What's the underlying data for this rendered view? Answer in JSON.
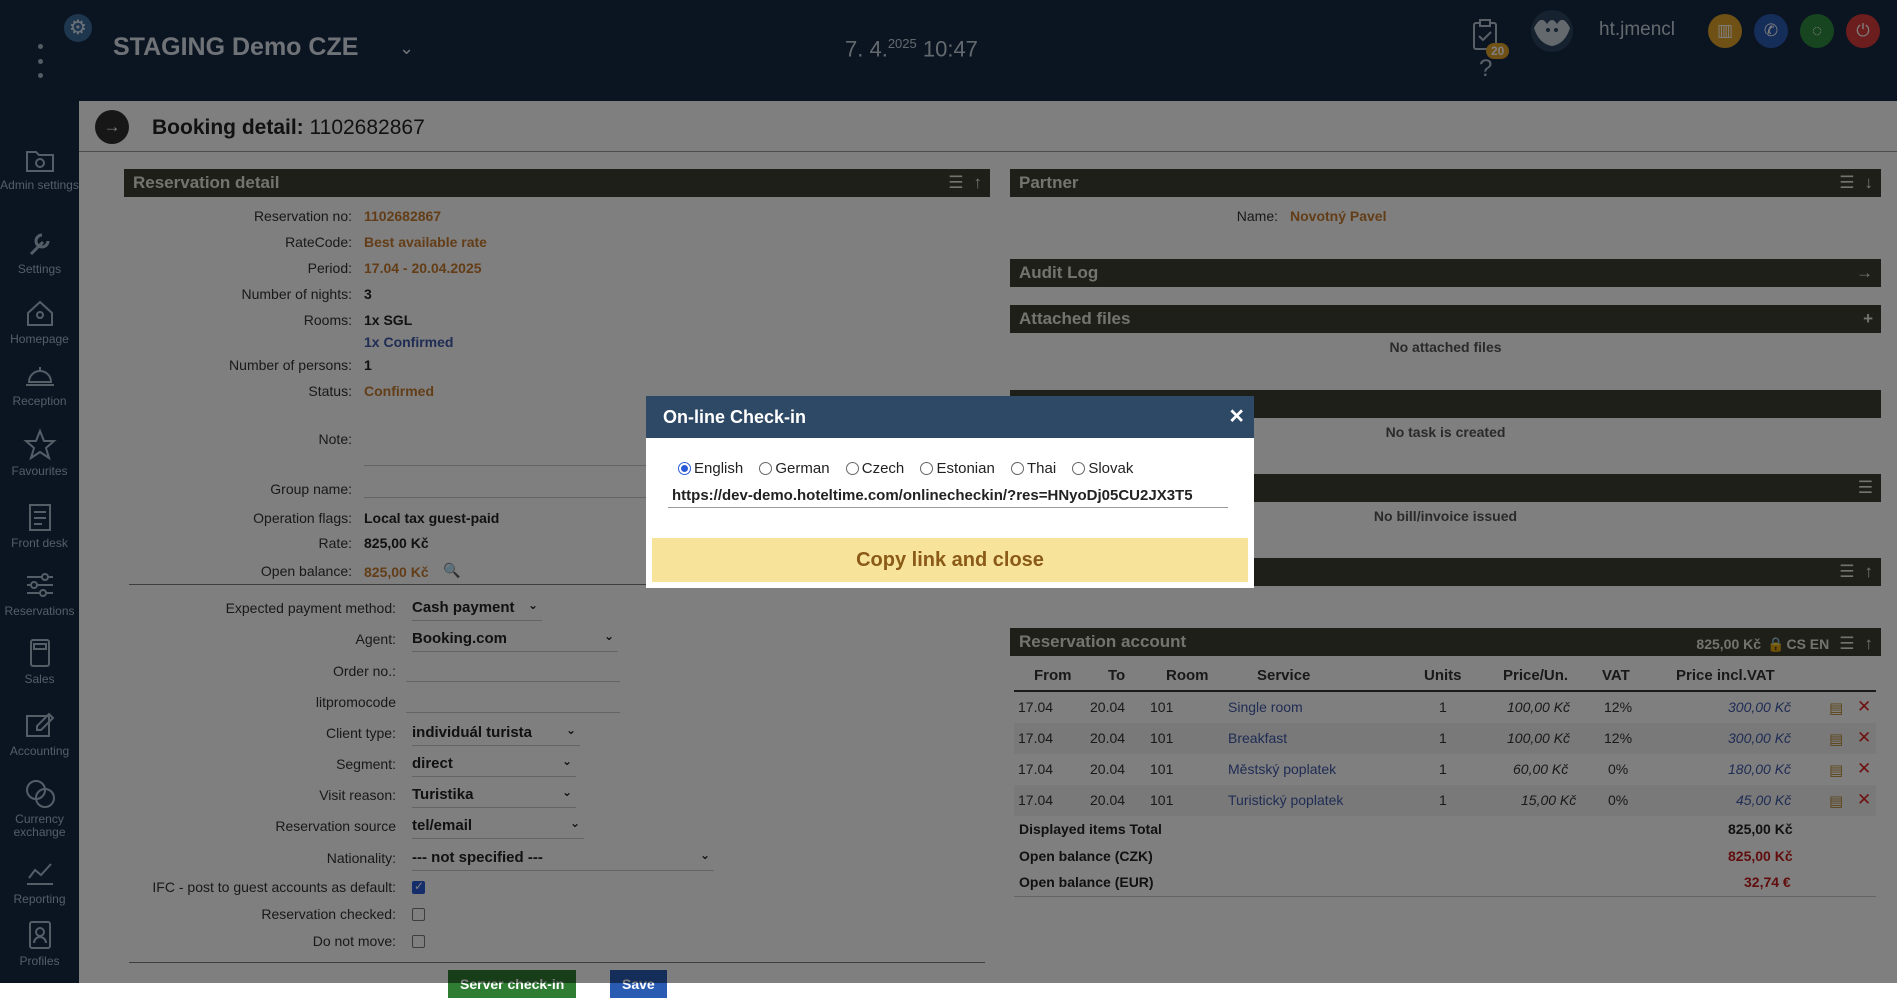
{
  "sidebar": {
    "items": [
      {
        "label": "Admin settings",
        "icon": "admin-settings-icon"
      },
      {
        "label": "Settings",
        "icon": "wrench-icon"
      },
      {
        "label": "Homepage",
        "icon": "home-icon"
      },
      {
        "label": "Reception",
        "icon": "bell-icon"
      },
      {
        "label": "Favourites",
        "icon": "star-icon"
      },
      {
        "label": "Front desk",
        "icon": "front-desk-icon"
      },
      {
        "label": "Reservations",
        "icon": "sliders-icon"
      },
      {
        "label": "Sales",
        "icon": "calculator-icon"
      },
      {
        "label": "Accounting",
        "icon": "accounting-icon"
      },
      {
        "label": "Currency exchange",
        "icon": "currency-icon"
      },
      {
        "label": "Reporting",
        "icon": "chart-icon"
      },
      {
        "label": "Profiles",
        "icon": "profiles-icon"
      }
    ]
  },
  "topbar": {
    "hotel": "STAGING Demo CZE",
    "date_day": "7. 4.",
    "date_year": "2025",
    "time": "10:47",
    "task_badge": "20",
    "user": "ht.jmencl"
  },
  "page": {
    "title_label": "Booking detail:",
    "title_value": "1102682867"
  },
  "reservation": {
    "panel_title": "Reservation detail",
    "fields": {
      "res_no_label": "Reservation no:",
      "res_no": "1102682867",
      "ratecode_label": "RateCode:",
      "ratecode": "Best available rate",
      "period_label": "Period:",
      "period": "17.04 - 20.04.2025",
      "nights_label": "Number of nights:",
      "nights": "3",
      "rooms_label": "Rooms:",
      "rooms": "1x SGL",
      "rooms_confirmed": "1x Confirmed",
      "persons_label": "Number of persons:",
      "persons": "1",
      "status_label": "Status:",
      "status": "Confirmed",
      "note_label": "Note:",
      "group_label": "Group name:",
      "flags_label": "Operation flags:",
      "flags": "Local tax guest-paid",
      "rate_label": "Rate:",
      "rate": "825,00 Kč",
      "balance_label": "Open balance:",
      "balance": "825,00 Kč"
    },
    "form": {
      "payment_label": "Expected payment method:",
      "payment": "Cash payment",
      "agent_label": "Agent:",
      "agent": "Booking.com",
      "order_label": "Order no.:",
      "promo_label": "litpromocode",
      "client_label": "Client type:",
      "client": "individuál turista",
      "segment_label": "Segment:",
      "segment": "direct",
      "visit_label": "Visit reason:",
      "visit": "Turistika",
      "source_label": "Reservation source",
      "source": "tel/email",
      "nationality_label": "Nationality:",
      "nationality": "--- not specified ---",
      "ifc_label": "IFC - post to guest accounts as default:",
      "checked_label": "Reservation checked:",
      "nomove_label": "Do not move:"
    }
  },
  "partner": {
    "panel_title": "Partner",
    "name_label": "Name:",
    "name": "Novotný Pavel"
  },
  "audit": {
    "panel_title": "Audit Log"
  },
  "files": {
    "panel_title": "Attached files",
    "empty": "No attached files"
  },
  "tasks": {
    "empty": "No task is created"
  },
  "bills": {
    "empty": "No bill/invoice issued"
  },
  "account": {
    "panel_title": "Reservation account",
    "summary": "825,00 Kč",
    "lang": "CS EN",
    "headers": [
      "From",
      "To",
      "Room",
      "Service",
      "Units",
      "Price/Un.",
      "VAT",
      "Price incl.VAT"
    ],
    "rows": [
      {
        "from": "17.04",
        "to": "20.04",
        "room": "101",
        "service": "Single room",
        "units": "1",
        "price": "100,00 Kč",
        "vat": "12%",
        "total": "300,00 Kč"
      },
      {
        "from": "17.04",
        "to": "20.04",
        "room": "101",
        "service": "Breakfast",
        "units": "1",
        "price": "100,00 Kč",
        "vat": "12%",
        "total": "300,00 Kč"
      },
      {
        "from": "17.04",
        "to": "20.04",
        "room": "101",
        "service": "Městský poplatek",
        "units": "1",
        "price": "60,00 Kč",
        "vat": "0%",
        "total": "180,00 Kč"
      },
      {
        "from": "17.04",
        "to": "20.04",
        "room": "101",
        "service": "Turistický poplatek",
        "units": "1",
        "price": "15,00 Kč",
        "vat": "0%",
        "total": "45,00 Kč"
      }
    ],
    "totals": {
      "displayed_label": "Displayed items Total",
      "displayed": "825,00 Kč",
      "czk_label": "Open balance (CZK)",
      "czk": "825,00 Kč",
      "eur_label": "Open balance (EUR)",
      "eur": "32,74 €"
    }
  },
  "bottom_buttons": {
    "checkin": "Server check-in",
    "save": "Save"
  },
  "modal": {
    "title": "On-line Check-in",
    "languages": [
      "English",
      "German",
      "Czech",
      "Estonian",
      "Thai",
      "Slovak"
    ],
    "selected_language": "English",
    "link": "https://dev-demo.hoteltime.com/onlinecheckin/?res=HNyoDj05CU2JX3T5",
    "copy_button": "Copy link and close"
  }
}
